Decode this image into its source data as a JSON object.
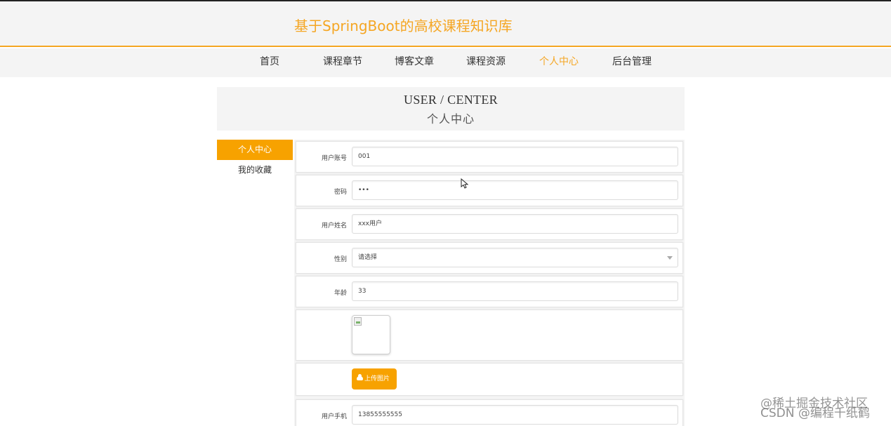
{
  "site": {
    "title": "基于SpringBoot的高校课程知识库"
  },
  "nav": {
    "items": [
      {
        "label": "首页"
      },
      {
        "label": "课程章节"
      },
      {
        "label": "博客文章"
      },
      {
        "label": "课程资源"
      },
      {
        "label": "个人中心"
      },
      {
        "label": "后台管理"
      }
    ],
    "active": "个人中心"
  },
  "banner": {
    "title_en": "USER / CENTER",
    "title_cn": "个人中心"
  },
  "sidebar": {
    "items": [
      {
        "label": "个人中心"
      },
      {
        "label": "我的收藏"
      }
    ]
  },
  "form": {
    "account": {
      "label": "用户账号",
      "value": "001"
    },
    "password": {
      "label": "密码",
      "value": "•••"
    },
    "name": {
      "label": "用户姓名",
      "value": "xxx用户"
    },
    "gender": {
      "label": "性别",
      "placeholder": "请选择"
    },
    "age": {
      "label": "年龄",
      "value": "33"
    },
    "upload": {
      "label": "上传图片"
    },
    "phone": {
      "label": "用户手机",
      "value": "13855555555"
    }
  },
  "watermark": {
    "line1": "@稀土掘金技术社区",
    "line2": "CSDN @编程千纸鹤"
  },
  "colors": {
    "accent": "#f5a623",
    "button": "#f7a200"
  }
}
